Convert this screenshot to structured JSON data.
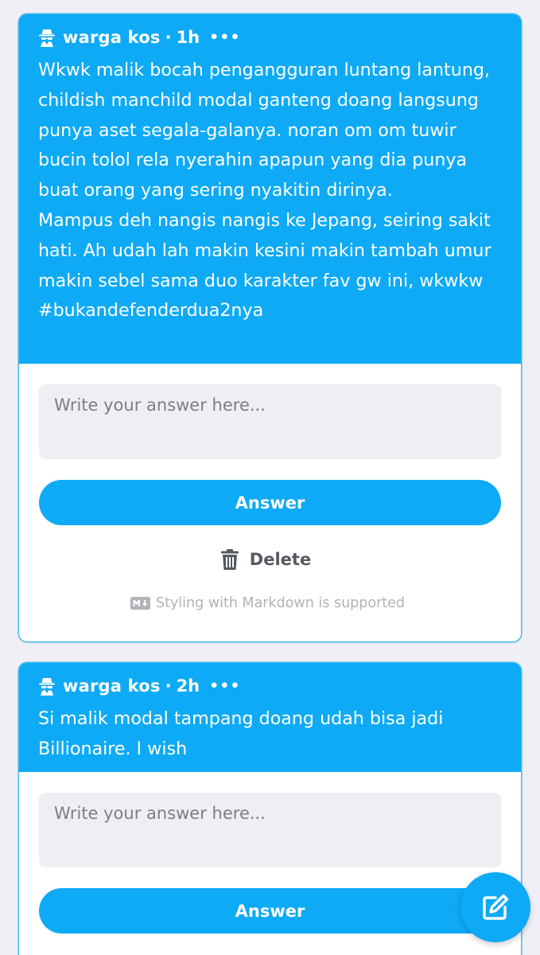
{
  "theme": {
    "accent": "#0eaaf5",
    "page_background": "#f0eff5",
    "input_background": "#efeef4"
  },
  "questions": [
    {
      "author": "warga kos",
      "separator": "·",
      "time": "1h",
      "more": "•••",
      "text": "Wkwk malik bocah pengangguran luntang lantung, childish manchild modal ganteng doang langsung punya aset segala-galanya. noran om om tuwir bucin tolol rela nyerahin apapun yang dia punya buat orang yang sering nyakitin dirinya.\nMampus deh nangis nangis ke Jepang, seiring sakit hati. Ah udah lah makin kesini makin tambah umur makin sebel sama duo karakter fav gw ini, wkwkw #bukandefenderdua2nya",
      "answer_placeholder": "Write your answer here...",
      "answer_label": "Answer",
      "delete_label": "Delete",
      "markdown_note": "Styling with Markdown is supported"
    },
    {
      "author": "warga kos",
      "separator": "·",
      "time": "2h",
      "more": "•••",
      "text": "Si malik modal tampang doang udah bisa jadi Billionaire. I wish",
      "answer_placeholder": "Write your answer here...",
      "answer_label": "Answer"
    }
  ],
  "icons": {
    "author_icon": "spy-icon",
    "delete_icon": "trash-icon",
    "markdown_icon": "markdown-icon",
    "fab_icon": "edit-icon"
  }
}
